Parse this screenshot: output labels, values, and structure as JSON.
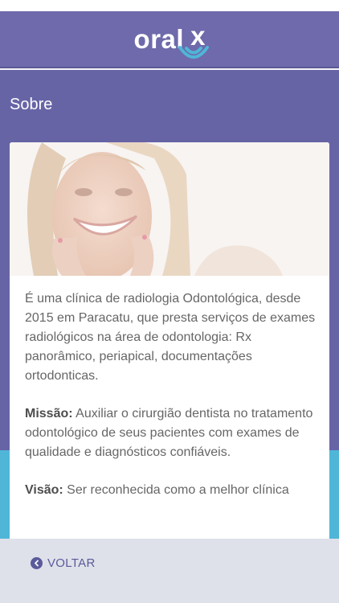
{
  "header": {
    "logo_text": "oral",
    "logo_x": "x"
  },
  "page": {
    "title": "Sobre"
  },
  "about": {
    "intro": "É uma clínica de radiologia Odontológica, desde 2015 em Paracatu, que presta serviços de exames radiológicos na área de odontologia: Rx panorâmico, periapical, documentações ortodonticas.",
    "mission_label": "Missão:",
    "mission_text": " Auxiliar o cirurgião dentista no tratamento odontológico de seus pacientes com exames de qualidade e diagnósticos confiáveis.",
    "vision_label": "Visão:",
    "vision_text": " Ser reconhecida como a melhor clínica"
  },
  "footer": {
    "back_label": "VOLTAR",
    "back_icon": "chevron-left-icon"
  },
  "colors": {
    "header": "#6e6aab",
    "background": "#6764a6",
    "accent_cyan": "#4fb6d8",
    "footer": "#dfe1ea",
    "button_text": "#5b5a9a"
  }
}
